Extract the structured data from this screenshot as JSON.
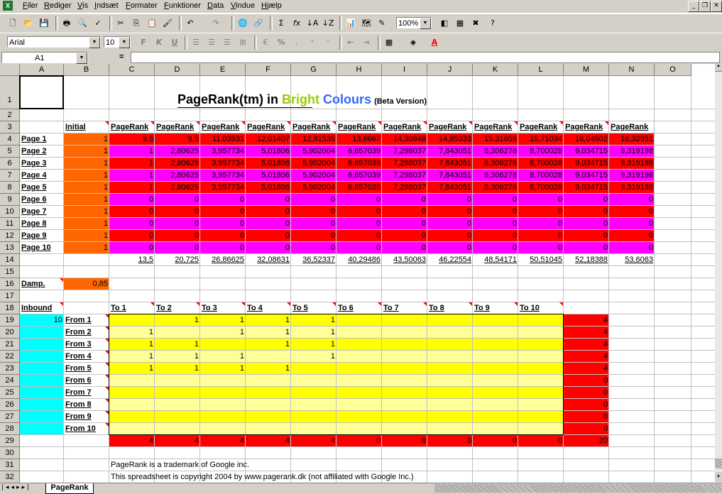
{
  "menu": [
    "Filer",
    "Rediger",
    "Vis",
    "Indsæt",
    "Formater",
    "Funktioner",
    "Data",
    "Vindue",
    "Hjælp"
  ],
  "toolbar": {
    "zoom": "100%",
    "font": "Arial",
    "size": "10",
    "bold": "F",
    "italic": "K",
    "underline": "U",
    "percent": "%"
  },
  "namebox": "A1",
  "formula_eq": "=",
  "columns": [
    "A",
    "B",
    "C",
    "D",
    "E",
    "F",
    "G",
    "H",
    "I",
    "J",
    "K",
    "L",
    "M",
    "N",
    "O"
  ],
  "rows": [
    "1",
    "2",
    "3",
    "4",
    "5",
    "6",
    "7",
    "8",
    "9",
    "10",
    "11",
    "12",
    "13",
    "14",
    "15",
    "16",
    "17",
    "18",
    "19",
    "20",
    "21",
    "22",
    "23",
    "24",
    "25",
    "26",
    "27",
    "28",
    "29",
    "30",
    "31",
    "32",
    "33"
  ],
  "title": {
    "pre": "PageRank(tm) in ",
    "w1": "Bright",
    "w2": "Colours",
    "post": "(Beta Version)"
  },
  "colors": {
    "red": "#ff0000",
    "magenta": "#ff00ff",
    "orange": "#ff6600",
    "cyan": "#00ffff",
    "yellow": "#ffff00",
    "lightyellow": "#ffff99",
    "bright": "#99cc00",
    "colours": "#3366ff"
  },
  "initial_header": "Initial",
  "pr_headers": [
    "PageRank",
    "PageRank",
    "PageRank",
    "PageRank",
    "PageRank",
    "PageRank",
    "PageRank",
    "PageRank",
    "PageRank",
    "PageRank",
    "PageRank",
    "PageRank"
  ],
  "pages": [
    "Page 1",
    "Page 2",
    "Page 3",
    "Page 4",
    "Page 5",
    "Page 6",
    "Page 7",
    "Page 8",
    "Page 9",
    "Page 10"
  ],
  "initial": [
    "1",
    "1",
    "1",
    "1",
    "1",
    "1",
    "1",
    "1",
    "1",
    "1"
  ],
  "pr_rows": [
    [
      "9,5",
      "9,5",
      "11,03531",
      "12,01407",
      "12,91535",
      "13,6667",
      "14,30848",
      "14,85333",
      "15,31659",
      "15,71034",
      "16,04502",
      "16,32951"
    ],
    [
      "1",
      "2,80625",
      "3,957734",
      "5,01806",
      "5,902004",
      "6,657039",
      "7,298037",
      "7,843051",
      "8,306278",
      "8,700028",
      "9,034715",
      "9,319198"
    ],
    [
      "1",
      "2,80625",
      "3,957734",
      "5,01806",
      "5,902004",
      "6,657039",
      "7,298037",
      "7,843051",
      "8,306278",
      "8,700028",
      "9,034715",
      "9,319198"
    ],
    [
      "1",
      "2,80625",
      "3,957734",
      "5,01806",
      "5,902004",
      "6,657039",
      "7,298037",
      "7,843051",
      "8,306278",
      "8,700028",
      "9,034715",
      "9,319198"
    ],
    [
      "1",
      "2,80625",
      "3,957734",
      "5,01806",
      "5,902004",
      "6,657039",
      "7,298037",
      "7,843051",
      "8,306278",
      "8,700028",
      "9,034715",
      "9,319198"
    ],
    [
      "0",
      "0",
      "0",
      "0",
      "0",
      "0",
      "0",
      "0",
      "0",
      "0",
      "0",
      "0"
    ],
    [
      "0",
      "0",
      "0",
      "0",
      "0",
      "0",
      "0",
      "0",
      "0",
      "0",
      "0",
      "0"
    ],
    [
      "0",
      "0",
      "0",
      "0",
      "0",
      "0",
      "0",
      "0",
      "0",
      "0",
      "0",
      "0"
    ],
    [
      "0",
      "0",
      "0",
      "0",
      "0",
      "0",
      "0",
      "0",
      "0",
      "0",
      "0",
      "0"
    ],
    [
      "0",
      "0",
      "0",
      "0",
      "0",
      "0",
      "0",
      "0",
      "0",
      "0",
      "0",
      "0"
    ]
  ],
  "pr_totals": [
    "13,5",
    "20,725",
    "26,86625",
    "32,08631",
    "36,52337",
    "40,29486",
    "43,50063",
    "46,22554",
    "48,54171",
    "50,51045",
    "52,18388",
    "53,6063"
  ],
  "damp_label": "Damp.",
  "damp_value": "0,85",
  "inbound_label": "Inbound",
  "inbound_value": "10",
  "to_labels": [
    "To 1",
    "To 2",
    "To 3",
    "To 4",
    "To 5",
    "To 6",
    "To 7",
    "To 8",
    "To 9",
    "To 10"
  ],
  "from_labels": [
    "From 1",
    "From 2",
    "From 3",
    "From 4",
    "From 5",
    "From 6",
    "From 7",
    "From 8",
    "From 9",
    "From 10"
  ],
  "links": [
    [
      "",
      "1",
      "1",
      "1",
      "1",
      "",
      "",
      "",
      "",
      ""
    ],
    [
      "1",
      "",
      "1",
      "1",
      "1",
      "",
      "",
      "",
      "",
      ""
    ],
    [
      "1",
      "1",
      "",
      "1",
      "1",
      "",
      "",
      "",
      "",
      ""
    ],
    [
      "1",
      "1",
      "1",
      "",
      "1",
      "",
      "",
      "",
      "",
      ""
    ],
    [
      "1",
      "1",
      "1",
      "1",
      "",
      "",
      "",
      "",
      "",
      ""
    ],
    [
      "",
      "",
      "",
      "",
      "",
      "",
      "",
      "",
      "",
      ""
    ],
    [
      "",
      "",
      "",
      "",
      "",
      "",
      "",
      "",
      "",
      ""
    ],
    [
      "",
      "",
      "",
      "",
      "",
      "",
      "",
      "",
      "",
      ""
    ],
    [
      "",
      "",
      "",
      "",
      "",
      "",
      "",
      "",
      "",
      ""
    ],
    [
      "",
      "",
      "",
      "",
      "",
      "",
      "",
      "",
      "",
      ""
    ]
  ],
  "out_counts": [
    "4",
    "4",
    "4",
    "4",
    "4",
    "0",
    "0",
    "0",
    "0",
    "0"
  ],
  "link_totals": [
    "4",
    "4",
    "4",
    "4",
    "4",
    "0",
    "0",
    "0",
    "0",
    "0"
  ],
  "grand_total": "20",
  "footer1": "PageRank is a trademark of Google inc.",
  "footer2": "This spreadsheet is copyright 2004 by www.pagerank.dk (not affiliated with Google Inc.)",
  "sheet_tab": "PageRank"
}
